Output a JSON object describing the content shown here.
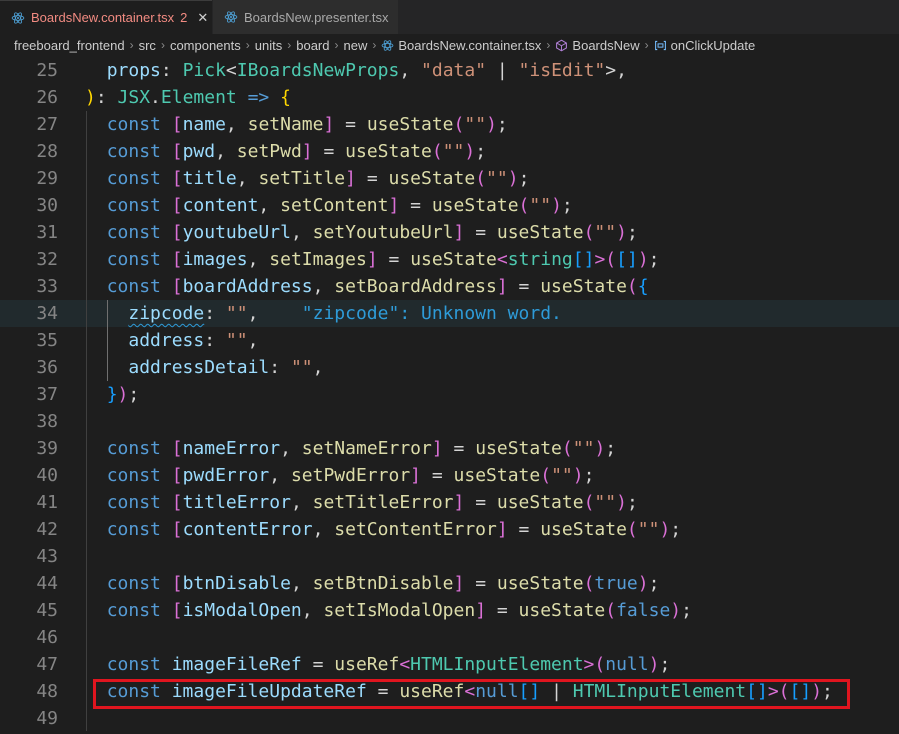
{
  "tabs": [
    {
      "label": "BoardsNew.container.tsx",
      "badge": "2",
      "active": true
    },
    {
      "label": "BoardsNew.presenter.tsx",
      "active": false
    }
  ],
  "breadcrumb": [
    "freeboard_frontend",
    "src",
    "components",
    "units",
    "board",
    "new",
    "BoardsNew.container.tsx",
    "BoardsNew",
    "onClickUpdate"
  ],
  "colors": {
    "keyword": "#569cd6",
    "variable": "#9cdcfe",
    "function": "#dcdcaa",
    "type": "#4ec9b0",
    "string": "#ce9178",
    "highlight_box": "#e0151f"
  },
  "code": {
    "line_numbers": [
      "25",
      "26",
      "27",
      "28",
      "29",
      "30",
      "31",
      "32",
      "33",
      "34",
      "35",
      "36",
      "37",
      "38",
      "39",
      "40",
      "41",
      "42",
      "43",
      "44",
      "45",
      "46",
      "47",
      "48",
      "49"
    ],
    "current_line": "34",
    "diagnostic": "\"zipcode\": Unknown word.",
    "lines": [
      "  props: Pick<IBoardsNewProps, \"data\" | \"isEdit\">,",
      "): JSX.Element => {",
      "  const [name, setName] = useState(\"\");",
      "  const [pwd, setPwd] = useState(\"\");",
      "  const [title, setTitle] = useState(\"\");",
      "  const [content, setContent] = useState(\"\");",
      "  const [youtubeUrl, setYoutubeUrl] = useState(\"\");",
      "  const [images, setImages] = useState<string[]>([]);",
      "  const [boardAddress, setBoardAddress] = useState({",
      "    zipcode: \"\",",
      "    address: \"\",",
      "    addressDetail: \"\",",
      "  });",
      "",
      "  const [nameError, setNameError] = useState(\"\");",
      "  const [pwdError, setPwdError] = useState(\"\");",
      "  const [titleError, setTitleError] = useState(\"\");",
      "  const [contentError, setContentError] = useState(\"\");",
      "",
      "  const [btnDisable, setBtnDisable] = useState(true);",
      "  const [isModalOpen, setIsModalOpen] = useState(false);",
      "",
      "  const imageFileRef = useRef<HTMLInputElement>(null);",
      "  const imageFileUpdateRef = useRef<null[] | HTMLInputElement[]>([]);",
      ""
    ]
  }
}
